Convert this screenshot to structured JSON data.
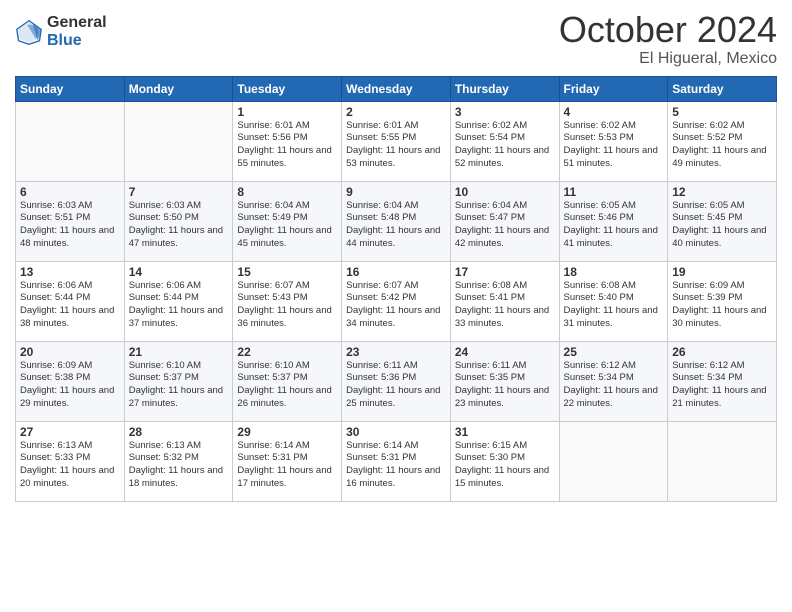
{
  "header": {
    "logo_general": "General",
    "logo_blue": "Blue",
    "month": "October 2024",
    "location": "El Higueral, Mexico"
  },
  "weekdays": [
    "Sunday",
    "Monday",
    "Tuesday",
    "Wednesday",
    "Thursday",
    "Friday",
    "Saturday"
  ],
  "weeks": [
    [
      {
        "day": "",
        "sunrise": "",
        "sunset": "",
        "daylight": ""
      },
      {
        "day": "",
        "sunrise": "",
        "sunset": "",
        "daylight": ""
      },
      {
        "day": "1",
        "sunrise": "Sunrise: 6:01 AM",
        "sunset": "Sunset: 5:56 PM",
        "daylight": "Daylight: 11 hours and 55 minutes."
      },
      {
        "day": "2",
        "sunrise": "Sunrise: 6:01 AM",
        "sunset": "Sunset: 5:55 PM",
        "daylight": "Daylight: 11 hours and 53 minutes."
      },
      {
        "day": "3",
        "sunrise": "Sunrise: 6:02 AM",
        "sunset": "Sunset: 5:54 PM",
        "daylight": "Daylight: 11 hours and 52 minutes."
      },
      {
        "day": "4",
        "sunrise": "Sunrise: 6:02 AM",
        "sunset": "Sunset: 5:53 PM",
        "daylight": "Daylight: 11 hours and 51 minutes."
      },
      {
        "day": "5",
        "sunrise": "Sunrise: 6:02 AM",
        "sunset": "Sunset: 5:52 PM",
        "daylight": "Daylight: 11 hours and 49 minutes."
      }
    ],
    [
      {
        "day": "6",
        "sunrise": "Sunrise: 6:03 AM",
        "sunset": "Sunset: 5:51 PM",
        "daylight": "Daylight: 11 hours and 48 minutes."
      },
      {
        "day": "7",
        "sunrise": "Sunrise: 6:03 AM",
        "sunset": "Sunset: 5:50 PM",
        "daylight": "Daylight: 11 hours and 47 minutes."
      },
      {
        "day": "8",
        "sunrise": "Sunrise: 6:04 AM",
        "sunset": "Sunset: 5:49 PM",
        "daylight": "Daylight: 11 hours and 45 minutes."
      },
      {
        "day": "9",
        "sunrise": "Sunrise: 6:04 AM",
        "sunset": "Sunset: 5:48 PM",
        "daylight": "Daylight: 11 hours and 44 minutes."
      },
      {
        "day": "10",
        "sunrise": "Sunrise: 6:04 AM",
        "sunset": "Sunset: 5:47 PM",
        "daylight": "Daylight: 11 hours and 42 minutes."
      },
      {
        "day": "11",
        "sunrise": "Sunrise: 6:05 AM",
        "sunset": "Sunset: 5:46 PM",
        "daylight": "Daylight: 11 hours and 41 minutes."
      },
      {
        "day": "12",
        "sunrise": "Sunrise: 6:05 AM",
        "sunset": "Sunset: 5:45 PM",
        "daylight": "Daylight: 11 hours and 40 minutes."
      }
    ],
    [
      {
        "day": "13",
        "sunrise": "Sunrise: 6:06 AM",
        "sunset": "Sunset: 5:44 PM",
        "daylight": "Daylight: 11 hours and 38 minutes."
      },
      {
        "day": "14",
        "sunrise": "Sunrise: 6:06 AM",
        "sunset": "Sunset: 5:44 PM",
        "daylight": "Daylight: 11 hours and 37 minutes."
      },
      {
        "day": "15",
        "sunrise": "Sunrise: 6:07 AM",
        "sunset": "Sunset: 5:43 PM",
        "daylight": "Daylight: 11 hours and 36 minutes."
      },
      {
        "day": "16",
        "sunrise": "Sunrise: 6:07 AM",
        "sunset": "Sunset: 5:42 PM",
        "daylight": "Daylight: 11 hours and 34 minutes."
      },
      {
        "day": "17",
        "sunrise": "Sunrise: 6:08 AM",
        "sunset": "Sunset: 5:41 PM",
        "daylight": "Daylight: 11 hours and 33 minutes."
      },
      {
        "day": "18",
        "sunrise": "Sunrise: 6:08 AM",
        "sunset": "Sunset: 5:40 PM",
        "daylight": "Daylight: 11 hours and 31 minutes."
      },
      {
        "day": "19",
        "sunrise": "Sunrise: 6:09 AM",
        "sunset": "Sunset: 5:39 PM",
        "daylight": "Daylight: 11 hours and 30 minutes."
      }
    ],
    [
      {
        "day": "20",
        "sunrise": "Sunrise: 6:09 AM",
        "sunset": "Sunset: 5:38 PM",
        "daylight": "Daylight: 11 hours and 29 minutes."
      },
      {
        "day": "21",
        "sunrise": "Sunrise: 6:10 AM",
        "sunset": "Sunset: 5:37 PM",
        "daylight": "Daylight: 11 hours and 27 minutes."
      },
      {
        "day": "22",
        "sunrise": "Sunrise: 6:10 AM",
        "sunset": "Sunset: 5:37 PM",
        "daylight": "Daylight: 11 hours and 26 minutes."
      },
      {
        "day": "23",
        "sunrise": "Sunrise: 6:11 AM",
        "sunset": "Sunset: 5:36 PM",
        "daylight": "Daylight: 11 hours and 25 minutes."
      },
      {
        "day": "24",
        "sunrise": "Sunrise: 6:11 AM",
        "sunset": "Sunset: 5:35 PM",
        "daylight": "Daylight: 11 hours and 23 minutes."
      },
      {
        "day": "25",
        "sunrise": "Sunrise: 6:12 AM",
        "sunset": "Sunset: 5:34 PM",
        "daylight": "Daylight: 11 hours and 22 minutes."
      },
      {
        "day": "26",
        "sunrise": "Sunrise: 6:12 AM",
        "sunset": "Sunset: 5:34 PM",
        "daylight": "Daylight: 11 hours and 21 minutes."
      }
    ],
    [
      {
        "day": "27",
        "sunrise": "Sunrise: 6:13 AM",
        "sunset": "Sunset: 5:33 PM",
        "daylight": "Daylight: 11 hours and 20 minutes."
      },
      {
        "day": "28",
        "sunrise": "Sunrise: 6:13 AM",
        "sunset": "Sunset: 5:32 PM",
        "daylight": "Daylight: 11 hours and 18 minutes."
      },
      {
        "day": "29",
        "sunrise": "Sunrise: 6:14 AM",
        "sunset": "Sunset: 5:31 PM",
        "daylight": "Daylight: 11 hours and 17 minutes."
      },
      {
        "day": "30",
        "sunrise": "Sunrise: 6:14 AM",
        "sunset": "Sunset: 5:31 PM",
        "daylight": "Daylight: 11 hours and 16 minutes."
      },
      {
        "day": "31",
        "sunrise": "Sunrise: 6:15 AM",
        "sunset": "Sunset: 5:30 PM",
        "daylight": "Daylight: 11 hours and 15 minutes."
      },
      {
        "day": "",
        "sunrise": "",
        "sunset": "",
        "daylight": ""
      },
      {
        "day": "",
        "sunrise": "",
        "sunset": "",
        "daylight": ""
      }
    ]
  ]
}
